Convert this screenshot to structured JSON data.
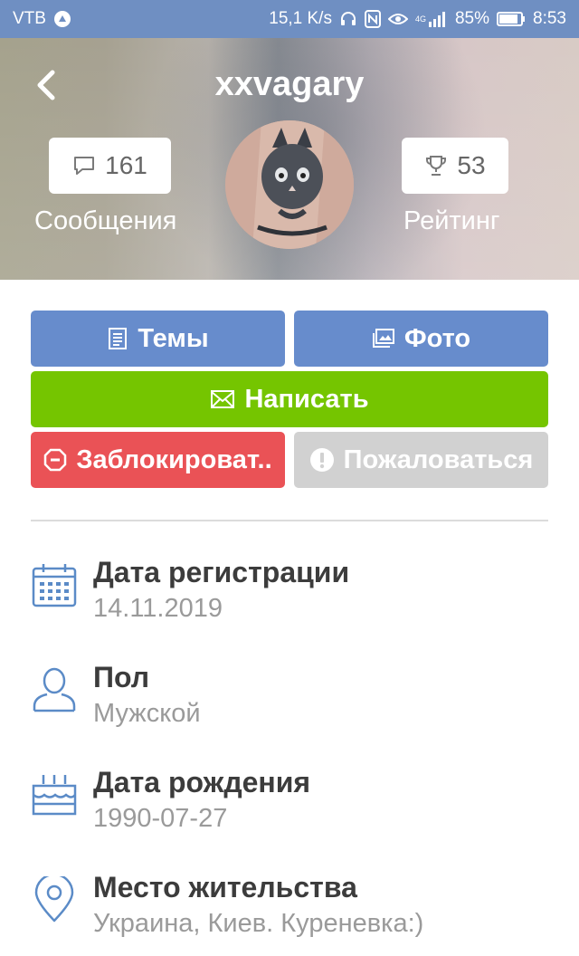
{
  "status_bar": {
    "carrier": "VTB",
    "speed": "15,1 K/s",
    "network": "4G",
    "battery": "85%",
    "time": "8:53"
  },
  "profile": {
    "username": "xxvagary",
    "messages_count": "161",
    "messages_label": "Сообщения",
    "rating_count": "53",
    "rating_label": "Рейтинг"
  },
  "actions": {
    "topics": "Темы",
    "photos": "Фото",
    "write": "Написать",
    "block": "Заблокироват..",
    "report": "Пожаловаться"
  },
  "info": [
    {
      "title": "Дата регистрации",
      "value": "14.11.2019",
      "icon": "calendar-icon"
    },
    {
      "title": "Пол",
      "value": "Мужской",
      "icon": "user-icon"
    },
    {
      "title": "Дата рождения",
      "value": "1990-07-27",
      "icon": "cake-icon"
    },
    {
      "title": "Место жительства",
      "value": "Украина, Киев. Куреневка:)",
      "icon": "location-pin-icon"
    }
  ],
  "colors": {
    "status_bar": "#6f8fc2",
    "primary_blue": "#678ccc",
    "write_green": "#75c500",
    "block_red": "#ea5256",
    "report_grey": "#d1d1d1",
    "icon_blue": "#5b8bc7"
  }
}
